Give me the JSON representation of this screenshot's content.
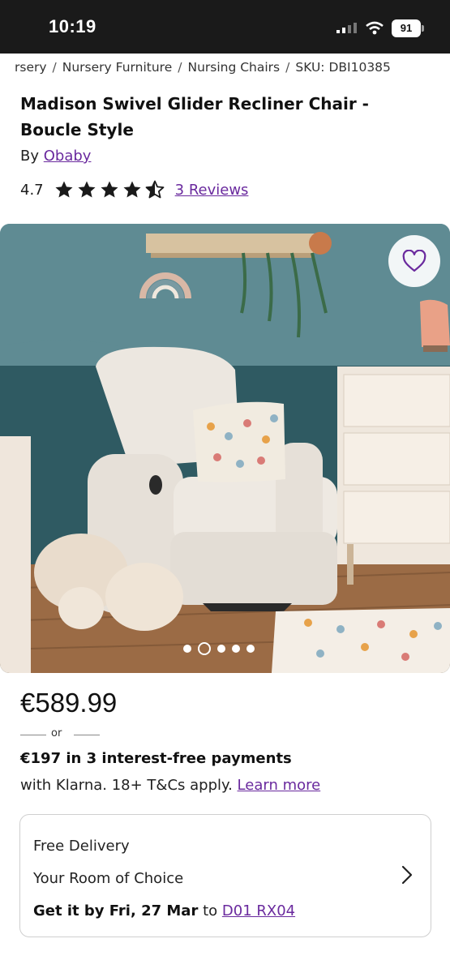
{
  "status_bar": {
    "time": "10:19",
    "battery": "91"
  },
  "breadcrumb": {
    "items": [
      "rsery",
      "Nursery Furniture",
      "Nursing Chairs",
      "SKU: DBI10385"
    ],
    "separator": "/"
  },
  "product": {
    "title": "Madison Swivel Glider Recliner Chair - Boucle Style",
    "by_prefix": "By",
    "brand": "Obaby",
    "rating": "4.7",
    "stars_value": 4.7,
    "stars_max": 5,
    "reviews_link": "3 Reviews"
  },
  "gallery": {
    "image_count": 5,
    "active_index": 1
  },
  "pricing": {
    "price": "€589.99",
    "or": "or",
    "installments": "€197 in 3 interest-free payments",
    "klarna_text": "with Klarna. 18+ T&Cs apply.",
    "learn_more": "Learn more"
  },
  "delivery": {
    "line1": "Free Delivery",
    "line2": "Your Room of Choice",
    "eta": "Get it by Fri, 27 Mar",
    "to": "to",
    "postcode": "D01 RX04"
  },
  "colors": {
    "accent": "#6a2a9e",
    "star": "#1a1a1a",
    "wall": "#5f8b93",
    "status_bar": "#1a1a1a"
  }
}
